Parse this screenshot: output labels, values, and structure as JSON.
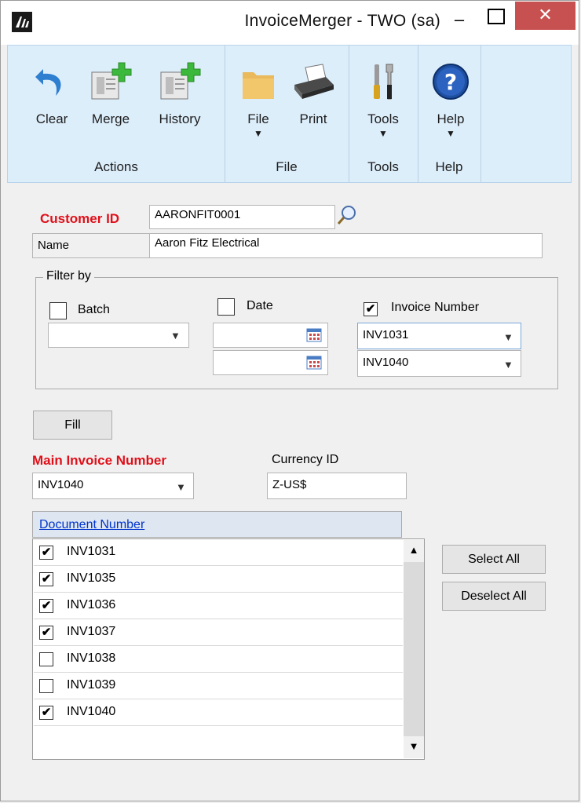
{
  "window": {
    "title": "InvoiceMerger  -  TWO (sa)",
    "min": "–",
    "close": "✕"
  },
  "ribbon": {
    "groups": [
      {
        "label": "Actions"
      },
      {
        "label": "File"
      },
      {
        "label": "Tools"
      },
      {
        "label": "Help"
      }
    ],
    "buttons": {
      "clear": "Clear",
      "merge": "Merge",
      "history": "History",
      "file": "File",
      "print": "Print",
      "tools": "Tools",
      "help": "Help"
    }
  },
  "form": {
    "customer_id_label": "Customer ID",
    "customer_id_value": "AARONFIT0001",
    "name_label": "Name",
    "name_value": "Aaron Fitz Electrical",
    "filter_legend": "Filter by",
    "batch_label": "Batch",
    "date_label": "Date",
    "invoice_number_label": "Invoice Number",
    "invoice_from": "INV1031",
    "invoice_to": "INV1040",
    "fill_button": "Fill",
    "main_invoice_label": "Main Invoice Number",
    "main_invoice_value": "INV1040",
    "currency_label": "Currency ID",
    "currency_value": "Z-US$"
  },
  "grid": {
    "header": "Document Number",
    "rows": [
      {
        "doc": "INV1031",
        "checked": true
      },
      {
        "doc": "INV1035",
        "checked": true
      },
      {
        "doc": "INV1036",
        "checked": true
      },
      {
        "doc": "INV1037",
        "checked": true
      },
      {
        "doc": "INV1038",
        "checked": false
      },
      {
        "doc": "INV1039",
        "checked": false
      },
      {
        "doc": "INV1040",
        "checked": true
      }
    ]
  },
  "buttons": {
    "select_all": "Select All",
    "deselect_all": "Deselect All"
  },
  "colors": {
    "required_label": "#e0101a",
    "close_button": "#c75050",
    "ribbon_bg": "#ddeefb",
    "link": "#0033cc"
  }
}
